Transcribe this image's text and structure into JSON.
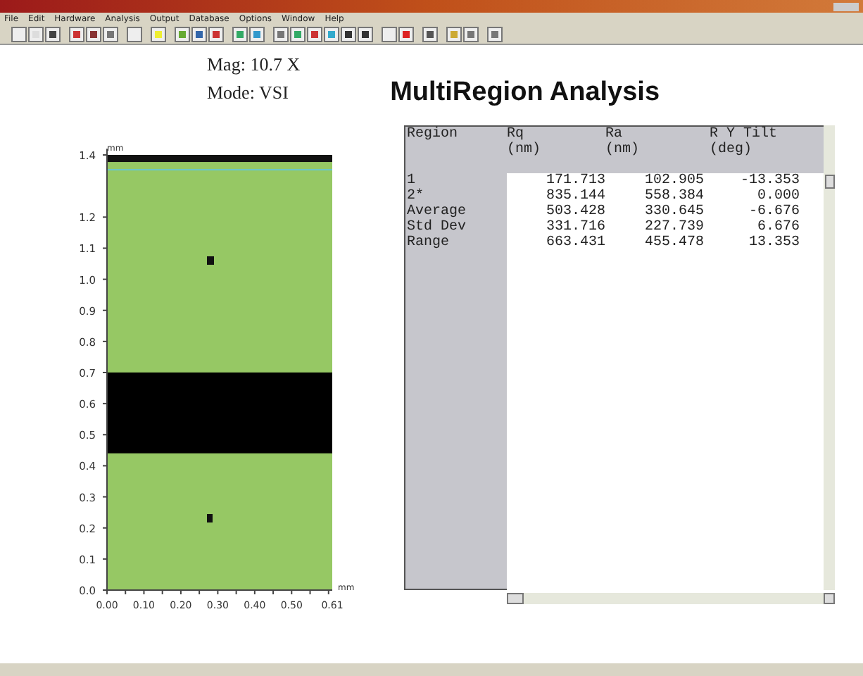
{
  "menu": [
    "File",
    "Edit",
    "Hardware",
    "Analysis",
    "Output",
    "Database",
    "Options",
    "Window",
    "Help"
  ],
  "info": {
    "mag": "Mag:  10.7 X",
    "mode": "Mode:  VSI"
  },
  "title": "MultiRegion Analysis",
  "plot": {
    "y_unit": "mm",
    "x_unit": "mm",
    "yticks": [
      "1.4",
      "1.2",
      "1.1",
      "1.0",
      "0.9",
      "0.8",
      "0.7",
      "0.6",
      "0.5",
      "0.4",
      "0.3",
      "0.2",
      "0.1",
      "0.0"
    ],
    "xticks": [
      "0.00",
      "0.10",
      "0.20",
      "0.30",
      "0.40",
      "0.50",
      "0.61"
    ]
  },
  "table": {
    "columns": [
      {
        "name": "Region"
      },
      {
        "name": "Rq",
        "unit": "(nm)"
      },
      {
        "name": "Ra",
        "unit": "(nm)"
      },
      {
        "name": "R Y Tilt",
        "unit": "(deg)"
      }
    ],
    "rows": [
      [
        "1",
        "171.713",
        "102.905",
        "-13.353"
      ],
      [
        "2*",
        "835.144",
        "558.384",
        "0.000"
      ],
      [
        "Average",
        "503.428",
        "330.645",
        "-6.676"
      ],
      [
        "Std Dev",
        "331.716",
        "227.739",
        "6.676"
      ],
      [
        "Range",
        "663.431",
        "455.478",
        "13.353"
      ]
    ]
  }
}
